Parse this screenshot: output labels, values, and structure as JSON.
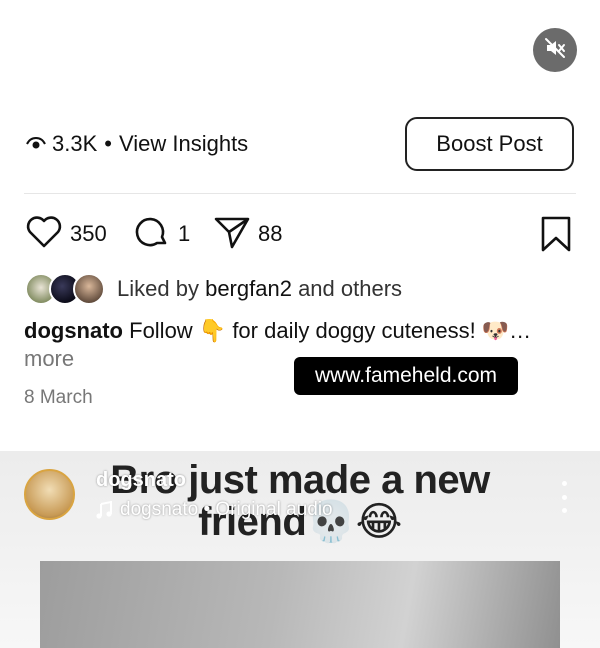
{
  "mute_button": {
    "icon": "speaker-muted-icon",
    "color": "#6b6b6b"
  },
  "insights": {
    "views_icon": "eye-icon",
    "views": "3.3K",
    "separator": "•",
    "link": "View Insights"
  },
  "boost_button": "Boost Post",
  "actions": {
    "likes": "350",
    "comments": "1",
    "shares": "88"
  },
  "liked_by": {
    "prefix": "Liked by",
    "user": "bergfan2",
    "suffix": "and others"
  },
  "caption": {
    "user": "dogsnato",
    "text": "Follow 👇  for daily doggy cuteness! 🐶…",
    "more": "more"
  },
  "watermark": "www.fameheld.com",
  "date": "8 March",
  "next_post": {
    "overlay_text_line1": "Bro just made a new",
    "overlay_text_line2": "friend💀😂",
    "username": "dogsnato",
    "audio": "dogsnato • Original audio"
  }
}
